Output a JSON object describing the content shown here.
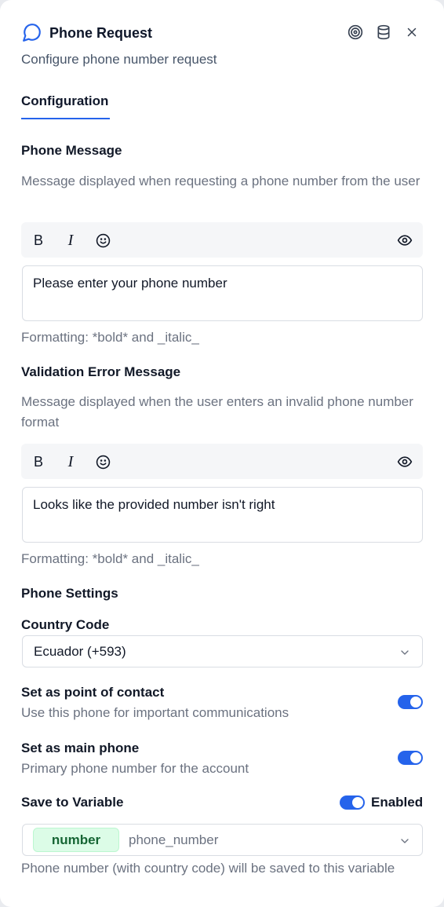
{
  "header": {
    "title": "Phone Request",
    "subtitle": "Configure phone number request",
    "icons": [
      "chat-bubble-icon",
      "target-icon",
      "database-icon",
      "close-icon"
    ]
  },
  "tabs": [
    {
      "label": "Configuration",
      "active": true
    }
  ],
  "phone_message": {
    "title": "Phone Message",
    "description": "Message displayed when requesting a phone number from the user",
    "toolbar": {
      "bold": "B",
      "italic": "I",
      "icons": [
        "bold-icon",
        "italic-icon",
        "emoji-icon",
        "eye-icon"
      ]
    },
    "value": "Please enter your phone number",
    "formatting_hint": "Formatting: *bold* and _italic_"
  },
  "validation_error": {
    "title": "Validation Error Message",
    "description": "Message displayed when the user enters an invalid phone number format",
    "toolbar": {
      "bold": "B",
      "italic": "I"
    },
    "value": "Looks like the provided number isn't right",
    "formatting_hint": "Formatting: *bold* and _italic_"
  },
  "phone_settings": {
    "title": "Phone Settings",
    "country_code_label": "Country Code",
    "country_code_value": "Ecuador (+593)",
    "point_of_contact": {
      "title": "Set as point of contact",
      "description": "Use this phone for important communications",
      "enabled": true
    },
    "main_phone": {
      "title": "Set as main phone",
      "description": "Primary phone number for the account",
      "enabled": true
    }
  },
  "save_to_variable": {
    "title": "Save to Variable",
    "enabled": true,
    "enabled_label": "Enabled",
    "type_badge": "number",
    "variable_name": "phone_number",
    "footnote": "Phone number (with country code) will be saved to this variable"
  },
  "colors": {
    "accent": "#2563eb",
    "badge_bg": "#dcfce7",
    "badge_text": "#166534",
    "muted_text": "#6b7280"
  }
}
